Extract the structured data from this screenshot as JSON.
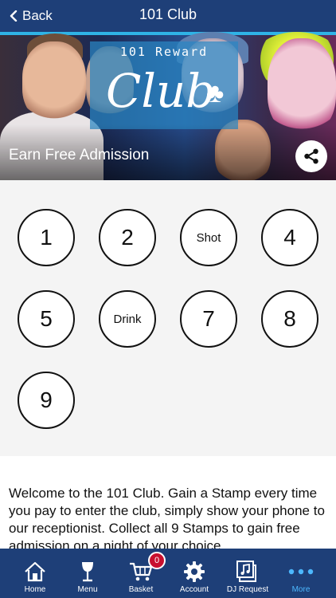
{
  "nav": {
    "back_label": "Back",
    "title": "101 Club"
  },
  "hero": {
    "logo_top": "101 Reward",
    "logo_script": "Club",
    "logo_mark": "♣",
    "caption": "Earn Free Admission"
  },
  "stamps": {
    "s1": "1",
    "s2": "2",
    "s3": "Shot",
    "s4": "4",
    "s5": "5",
    "s6": "Drink",
    "s7": "7",
    "s8": "8",
    "s9": "9"
  },
  "description": "Welcome to the 101 Club. Gain a Stamp every time you pay to enter the club, simply show your phone to our receptionist. Collect all 9 Stamps to gain free admission on a night of your choice.",
  "tabbar": {
    "home": "Home",
    "menu": "Menu",
    "basket": "Basket",
    "basket_count": "0",
    "account": "Account",
    "dj": "DJ Request",
    "more": "More"
  },
  "colors": {
    "bar": "#1e3f78",
    "active_tab": "#4cb8ff",
    "badge": "#c8102e"
  }
}
